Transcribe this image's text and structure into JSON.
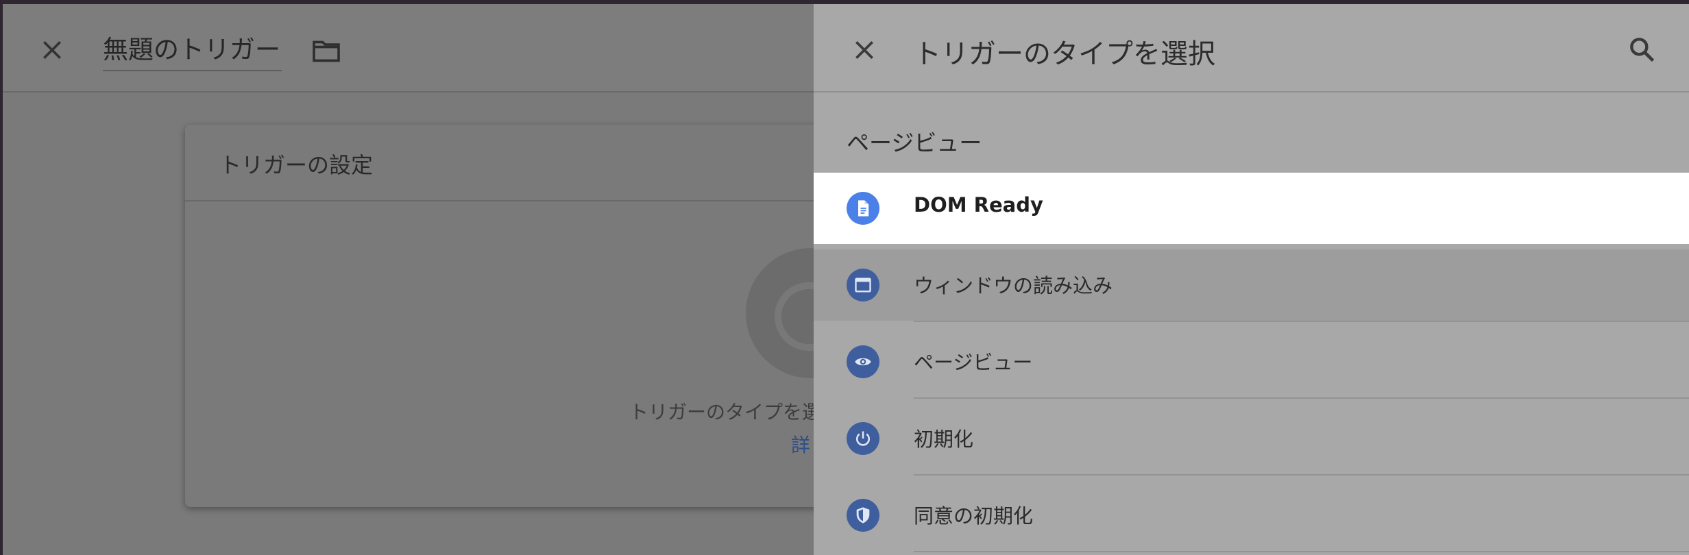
{
  "editor": {
    "title": "無題のトリガー",
    "card_title": "トリガーの設定",
    "hint_text": "トリガーのタイプを選",
    "link_text": "詳"
  },
  "panel": {
    "title": "トリガーのタイプを選択",
    "section_heading": "ページビュー",
    "items": [
      {
        "label": "DOM Ready",
        "icon": "document-icon",
        "state": "selected"
      },
      {
        "label": "ウィンドウの読み込み",
        "icon": "window-icon",
        "state": "hover"
      },
      {
        "label": "ページビュー",
        "icon": "eye-icon",
        "state": "normal"
      },
      {
        "label": "初期化",
        "icon": "power-icon",
        "state": "normal"
      },
      {
        "label": "同意の初期化",
        "icon": "shield-icon",
        "state": "normal"
      }
    ]
  },
  "colors": {
    "accent": "#4a80e8",
    "icon_bg": "#3f5e9e",
    "panel_bg": "#a8a8a8",
    "overlay_bg": "#7a7a7a"
  }
}
